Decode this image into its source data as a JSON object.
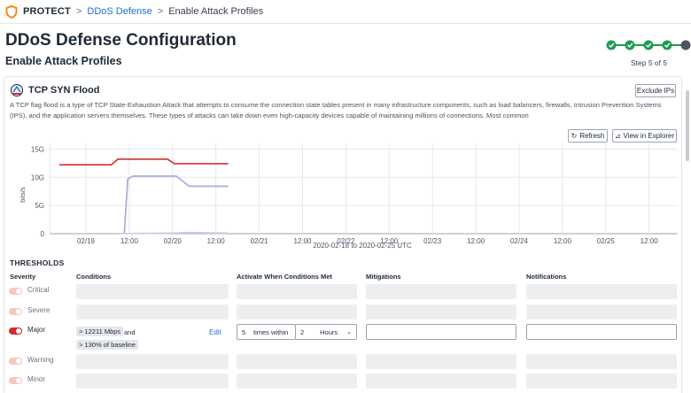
{
  "nav": {
    "brand": "PROTECT",
    "sep": ">",
    "crumb_link": "DDoS Defense",
    "crumb_current": "Enable Attack Profiles",
    "brand_color": "#f28c1b"
  },
  "header": {
    "title": "DDoS Defense Configuration",
    "subtitle": "Enable Attack Profiles",
    "step_label": "Step 5 of 5",
    "steps_completed": 4,
    "steps_total": 5
  },
  "profile": {
    "title": "TCP SYN Flood",
    "exclude_label": "Exclude IPs",
    "description": "A TCP flag flood is a type of TCP State-Exhaustion Attack that attempts to consume the connection state tables present in many infrastructure components, such as load balancers, firewalls, Intrusion Prevention Systems (IPS), and the application servers themselves. These types of attacks can take down even high-capacity devices capable of maintaining millions of connections. Most common",
    "refresh_label": "Refresh",
    "explorer_label": "View in Explorer"
  },
  "chart_data": {
    "type": "line",
    "ylabel": "bits/s",
    "xlabel": "2020-02-18 to 2020-02-25 UTC",
    "y_ticks": [
      "15G",
      "10G",
      "5G",
      "0"
    ],
    "y_values": [
      15,
      10,
      5,
      0
    ],
    "ylim": [
      0,
      16
    ],
    "x_tick_labels": [
      "02/19",
      "12:00",
      "02/20",
      "12:00",
      "02/21",
      "12:00",
      "02/22",
      "12:00",
      "02/23",
      "12:00",
      "02/24",
      "12:00",
      "02/25",
      "12:00"
    ],
    "grid": true,
    "series": [
      {
        "color": "#d0312d",
        "points": [
          [
            0.0,
            12.2
          ],
          [
            1.2,
            12.2
          ],
          [
            1.35,
            13.2
          ],
          [
            2.5,
            13.2
          ],
          [
            2.65,
            12.4
          ],
          [
            3.9,
            12.4
          ]
        ]
      },
      {
        "color": "#a7b2d6",
        "points": [
          [
            1.5,
            0.1
          ],
          [
            1.58,
            9.7
          ],
          [
            1.7,
            10.2
          ],
          [
            2.7,
            10.2
          ],
          [
            3.0,
            8.4
          ],
          [
            3.9,
            8.4
          ]
        ]
      },
      {
        "color": "#c9d0e4",
        "points": [
          [
            1.3,
            0.0
          ],
          [
            2.5,
            0.1
          ],
          [
            3.0,
            0.2
          ],
          [
            3.9,
            0.1
          ]
        ]
      }
    ]
  },
  "thresholds": {
    "title": "THRESHOLDS",
    "headers": {
      "severity": "Severity",
      "conditions": "Conditions",
      "activate": "Activate When Conditions Met",
      "mitigations": "Mitigations",
      "notifications": "Notifications"
    },
    "rows": [
      {
        "severity": "Critical",
        "enabled": false
      },
      {
        "severity": "Severe",
        "enabled": false
      },
      {
        "severity": "Major",
        "enabled": true
      },
      {
        "severity": "Warning",
        "enabled": false
      },
      {
        "severity": "Minor",
        "enabled": false
      }
    ],
    "major": {
      "condition_1": "> 12211 Mbps",
      "and_text": "and",
      "condition_2": "> 130% of baseline",
      "edit_label": "Edit",
      "count_value": "5",
      "times_within": "times within",
      "duration_value": "2",
      "duration_unit": "Hours"
    }
  }
}
